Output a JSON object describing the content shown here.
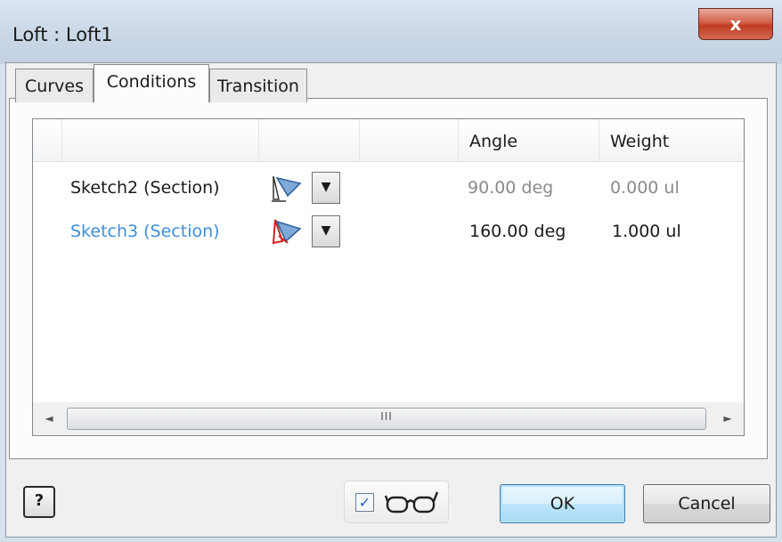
{
  "window": {
    "title": "Loft : Loft1",
    "close_label": "x"
  },
  "tabs": [
    {
      "label": "Curves",
      "active": false
    },
    {
      "label": "Conditions",
      "active": true
    },
    {
      "label": "Transition",
      "active": false
    }
  ],
  "grid": {
    "columns": [
      "",
      "",
      "",
      "Angle",
      "Weight"
    ],
    "rows": [
      {
        "label": "Sketch2 (Section)",
        "angle": "90.00 deg",
        "weight": "0.000 ul",
        "state": "disabled",
        "icon": "boundary-condition-icon"
      },
      {
        "label": "Sketch3 (Section)",
        "angle": "160.00 deg",
        "weight": "1.000 ul",
        "state": "selected",
        "icon": "boundary-condition-red-icon"
      }
    ],
    "scrollbar": {
      "thumb_grip": "III",
      "left_arrow": "◄",
      "right_arrow": "►"
    }
  },
  "footer": {
    "help_label": "?",
    "preview_checked": true,
    "preview_icon": "glasses-icon",
    "ok_label": "OK",
    "cancel_label": "Cancel"
  },
  "colors": {
    "accent": "#3f8fd8",
    "close": "#c03b22"
  }
}
